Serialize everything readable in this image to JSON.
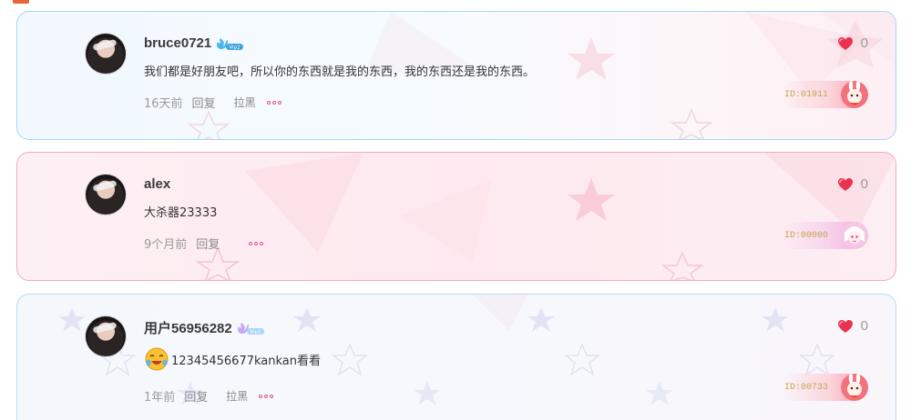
{
  "comments": [
    {
      "username": "bruce0721",
      "vip_badge": "vip-flame-blue",
      "content": "我们都是好朋友吧，所以你的东西就是我的东西，我的东西还是我的东西。",
      "time": "16天前",
      "reply_label": "回复",
      "block_label": "拉黑",
      "likes": "0",
      "id_label": "ID:01911",
      "theme": "blue"
    },
    {
      "username": "alex",
      "content": "大杀器23333",
      "time": "9个月前",
      "reply_label": "回复",
      "likes": "0",
      "id_label": "ID:00000",
      "theme": "pink"
    },
    {
      "username": "用户56956282",
      "vip_badge": "vip-flame-purple",
      "emoji": "crying-laughing-emoji",
      "content": "12345456677kankan看看",
      "time": "1年前",
      "reply_label": "回复",
      "block_label": "拉黑",
      "likes": "0",
      "id_label": "ID:00733",
      "theme": "lavender"
    }
  ],
  "colors": {
    "accent_pink": "#e45c7a",
    "heart_red": "#e8324f",
    "id_gold": "#c9a34e",
    "blue_border": "#a9d6ee",
    "pink_border": "#f5a9bd"
  }
}
